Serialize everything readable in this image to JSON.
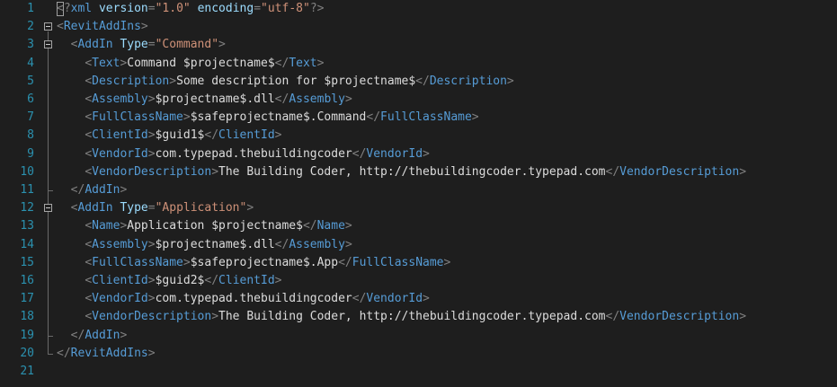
{
  "editor": {
    "language": "xml",
    "colors": {
      "background": "#1e1e1e",
      "line_number": "#2b91af",
      "delimiter": "#808080",
      "tag": "#569cd6",
      "attribute": "#9cdcfe",
      "attribute_value": "#ce9178",
      "text": "#dcdcdc"
    },
    "lines": [
      {
        "num": "1",
        "indent": "",
        "tokens": [
          [
            "d",
            "<?"
          ],
          [
            "t",
            "xml"
          ],
          [
            "x",
            " "
          ],
          [
            "a",
            "version"
          ],
          [
            "d",
            "="
          ],
          [
            "v",
            "\"1.0\""
          ],
          [
            "x",
            " "
          ],
          [
            "a",
            "encoding"
          ],
          [
            "d",
            "="
          ],
          [
            "v",
            "\"utf-8\""
          ],
          [
            "d",
            "?>"
          ]
        ]
      },
      {
        "num": "2",
        "indent": "",
        "fold": true,
        "tokens": [
          [
            "d",
            "<"
          ],
          [
            "t",
            "RevitAddIns"
          ],
          [
            "d",
            ">"
          ]
        ]
      },
      {
        "num": "3",
        "indent": "  ",
        "fold": true,
        "tokens": [
          [
            "d",
            "<"
          ],
          [
            "t",
            "AddIn"
          ],
          [
            "x",
            " "
          ],
          [
            "a",
            "Type"
          ],
          [
            "d",
            "="
          ],
          [
            "v",
            "\"Command\""
          ],
          [
            "d",
            ">"
          ]
        ]
      },
      {
        "num": "4",
        "indent": "    ",
        "tokens": [
          [
            "d",
            "<"
          ],
          [
            "t",
            "Text"
          ],
          [
            "d",
            ">"
          ],
          [
            "x",
            "Command $projectname$"
          ],
          [
            "d",
            "</"
          ],
          [
            "t",
            "Text"
          ],
          [
            "d",
            ">"
          ]
        ]
      },
      {
        "num": "5",
        "indent": "    ",
        "tokens": [
          [
            "d",
            "<"
          ],
          [
            "t",
            "Description"
          ],
          [
            "d",
            ">"
          ],
          [
            "x",
            "Some description for $projectname$"
          ],
          [
            "d",
            "</"
          ],
          [
            "t",
            "Description"
          ],
          [
            "d",
            ">"
          ]
        ]
      },
      {
        "num": "6",
        "indent": "    ",
        "tokens": [
          [
            "d",
            "<"
          ],
          [
            "t",
            "Assembly"
          ],
          [
            "d",
            ">"
          ],
          [
            "x",
            "$projectname$.dll"
          ],
          [
            "d",
            "</"
          ],
          [
            "t",
            "Assembly"
          ],
          [
            "d",
            ">"
          ]
        ]
      },
      {
        "num": "7",
        "indent": "    ",
        "tokens": [
          [
            "d",
            "<"
          ],
          [
            "t",
            "FullClassName"
          ],
          [
            "d",
            ">"
          ],
          [
            "x",
            "$safeprojectname$.Command"
          ],
          [
            "d",
            "</"
          ],
          [
            "t",
            "FullClassName"
          ],
          [
            "d",
            ">"
          ]
        ]
      },
      {
        "num": "8",
        "indent": "    ",
        "tokens": [
          [
            "d",
            "<"
          ],
          [
            "t",
            "ClientId"
          ],
          [
            "d",
            ">"
          ],
          [
            "x",
            "$guid1$"
          ],
          [
            "d",
            "</"
          ],
          [
            "t",
            "ClientId"
          ],
          [
            "d",
            ">"
          ]
        ]
      },
      {
        "num": "9",
        "indent": "    ",
        "tokens": [
          [
            "d",
            "<"
          ],
          [
            "t",
            "VendorId"
          ],
          [
            "d",
            ">"
          ],
          [
            "x",
            "com.typepad.thebuildingcoder"
          ],
          [
            "d",
            "</"
          ],
          [
            "t",
            "VendorId"
          ],
          [
            "d",
            ">"
          ]
        ]
      },
      {
        "num": "10",
        "indent": "    ",
        "tokens": [
          [
            "d",
            "<"
          ],
          [
            "t",
            "VendorDescription"
          ],
          [
            "d",
            ">"
          ],
          [
            "x",
            "The Building Coder, http://thebuildingcoder.typepad.com"
          ],
          [
            "d",
            "</"
          ],
          [
            "t",
            "VendorDescription"
          ],
          [
            "d",
            ">"
          ]
        ]
      },
      {
        "num": "11",
        "indent": "  ",
        "tokens": [
          [
            "d",
            "</"
          ],
          [
            "t",
            "AddIn"
          ],
          [
            "d",
            ">"
          ]
        ]
      },
      {
        "num": "12",
        "indent": "  ",
        "fold": true,
        "tokens": [
          [
            "d",
            "<"
          ],
          [
            "t",
            "AddIn"
          ],
          [
            "x",
            " "
          ],
          [
            "a",
            "Type"
          ],
          [
            "d",
            "="
          ],
          [
            "v",
            "\"Application\""
          ],
          [
            "d",
            ">"
          ]
        ]
      },
      {
        "num": "13",
        "indent": "    ",
        "tokens": [
          [
            "d",
            "<"
          ],
          [
            "t",
            "Name"
          ],
          [
            "d",
            ">"
          ],
          [
            "x",
            "Application $projectname$"
          ],
          [
            "d",
            "</"
          ],
          [
            "t",
            "Name"
          ],
          [
            "d",
            ">"
          ]
        ]
      },
      {
        "num": "14",
        "indent": "    ",
        "tokens": [
          [
            "d",
            "<"
          ],
          [
            "t",
            "Assembly"
          ],
          [
            "d",
            ">"
          ],
          [
            "x",
            "$projectname$.dll"
          ],
          [
            "d",
            "</"
          ],
          [
            "t",
            "Assembly"
          ],
          [
            "d",
            ">"
          ]
        ]
      },
      {
        "num": "15",
        "indent": "    ",
        "tokens": [
          [
            "d",
            "<"
          ],
          [
            "t",
            "FullClassName"
          ],
          [
            "d",
            ">"
          ],
          [
            "x",
            "$safeprojectname$.App"
          ],
          [
            "d",
            "</"
          ],
          [
            "t",
            "FullClassName"
          ],
          [
            "d",
            ">"
          ]
        ]
      },
      {
        "num": "16",
        "indent": "    ",
        "tokens": [
          [
            "d",
            "<"
          ],
          [
            "t",
            "ClientId"
          ],
          [
            "d",
            ">"
          ],
          [
            "x",
            "$guid2$"
          ],
          [
            "d",
            "</"
          ],
          [
            "t",
            "ClientId"
          ],
          [
            "d",
            ">"
          ]
        ]
      },
      {
        "num": "17",
        "indent": "    ",
        "tokens": [
          [
            "d",
            "<"
          ],
          [
            "t",
            "VendorId"
          ],
          [
            "d",
            ">"
          ],
          [
            "x",
            "com.typepad.thebuildingcoder"
          ],
          [
            "d",
            "</"
          ],
          [
            "t",
            "VendorId"
          ],
          [
            "d",
            ">"
          ]
        ]
      },
      {
        "num": "18",
        "indent": "    ",
        "tokens": [
          [
            "d",
            "<"
          ],
          [
            "t",
            "VendorDescription"
          ],
          [
            "d",
            ">"
          ],
          [
            "x",
            "The Building Coder, http://thebuildingcoder.typepad.com"
          ],
          [
            "d",
            "</"
          ],
          [
            "t",
            "VendorDescription"
          ],
          [
            "d",
            ">"
          ]
        ]
      },
      {
        "num": "19",
        "indent": "  ",
        "tokens": [
          [
            "d",
            "</"
          ],
          [
            "t",
            "AddIn"
          ],
          [
            "d",
            ">"
          ]
        ]
      },
      {
        "num": "20",
        "indent": "",
        "tokens": [
          [
            "d",
            "</"
          ],
          [
            "t",
            "RevitAddIns"
          ],
          [
            "d",
            ">"
          ]
        ]
      },
      {
        "num": "21",
        "indent": "",
        "tokens": []
      }
    ]
  }
}
